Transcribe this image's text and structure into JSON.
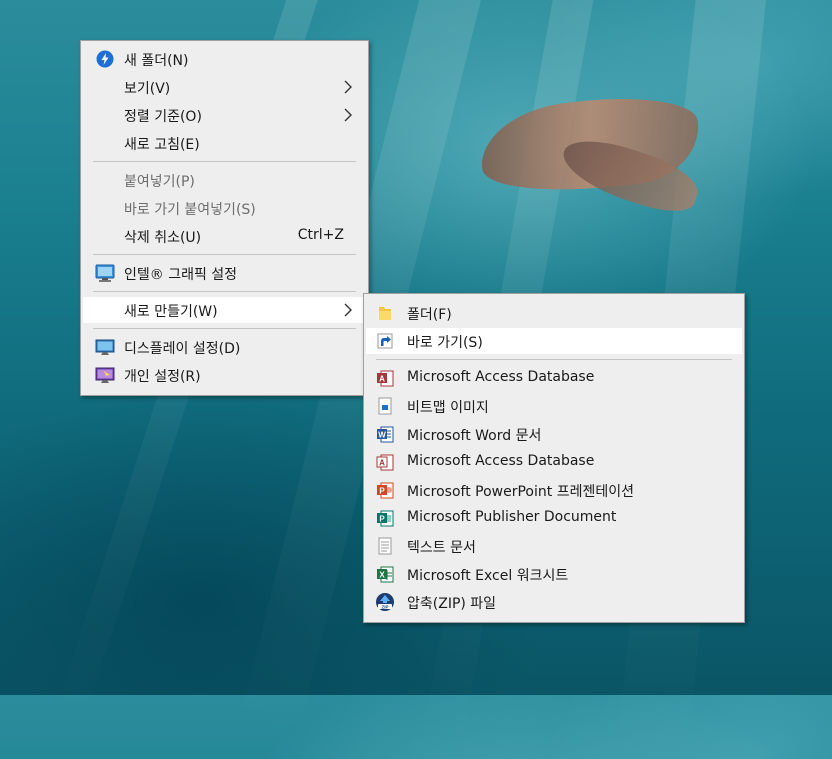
{
  "context_menu": {
    "items": [
      {
        "label": "새 폴더(N)",
        "icon": "onedrive-sync-icon"
      },
      {
        "label": "보기(V)",
        "has_submenu": true
      },
      {
        "label": "정렬 기준(O)",
        "has_submenu": true
      },
      {
        "label": "새로 고침(E)"
      },
      {
        "label": "붙여넣기(P)",
        "disabled": true
      },
      {
        "label": "바로 가기 붙여넣기(S)",
        "disabled": true
      },
      {
        "label": "삭제 취소(U)",
        "shortcut": "Ctrl+Z"
      },
      {
        "label": "인텔® 그래픽 설정",
        "icon": "intel-graphics-icon"
      },
      {
        "label": "새로 만들기(W)",
        "has_submenu": true,
        "highlighted": true
      },
      {
        "label": "디스플레이 설정(D)",
        "icon": "display-icon"
      },
      {
        "label": "개인 설정(R)",
        "icon": "personalize-icon"
      }
    ]
  },
  "new_submenu": {
    "items": [
      {
        "label": "폴더(F)",
        "icon": "folder-icon"
      },
      {
        "label": "바로 가기(S)",
        "icon": "shortcut-icon",
        "highlighted": true
      },
      {
        "label": "Microsoft Access Database",
        "icon": "access-icon"
      },
      {
        "label": "비트맵 이미지",
        "icon": "bitmap-icon"
      },
      {
        "label": "Microsoft Word 문서",
        "icon": "word-icon"
      },
      {
        "label": "Microsoft Access Database",
        "icon": "access-icon"
      },
      {
        "label": "Microsoft PowerPoint 프레젠테이션",
        "icon": "powerpoint-icon"
      },
      {
        "label": "Microsoft Publisher Document",
        "icon": "publisher-icon"
      },
      {
        "label": "텍스트 문서",
        "icon": "text-document-icon"
      },
      {
        "label": "Microsoft Excel 워크시트",
        "icon": "excel-icon"
      },
      {
        "label": "압축(ZIP) 파일",
        "icon": "zip-icon"
      }
    ]
  },
  "colors": {
    "menu_bg": "#eeeeee",
    "highlight_bg": "#ffffff",
    "disabled_text": "#6d6d6d",
    "access": "#a4373a",
    "word": "#2b579a",
    "powerpoint": "#d24726",
    "publisher": "#077568",
    "excel": "#217346"
  }
}
